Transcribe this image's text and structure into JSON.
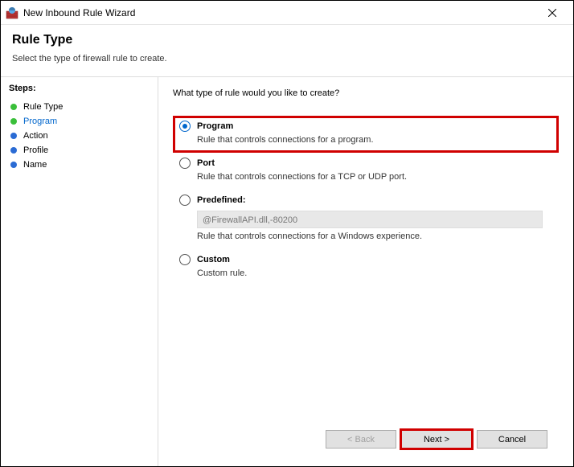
{
  "window": {
    "title": "New Inbound Rule Wizard"
  },
  "header": {
    "title": "Rule Type",
    "subtitle": "Select the type of firewall rule to create."
  },
  "sidebar": {
    "heading": "Steps:",
    "items": [
      {
        "label": "Rule Type",
        "bullet": "#3abf3a"
      },
      {
        "label": "Program",
        "bullet": "#3abf3a"
      },
      {
        "label": "Action",
        "bullet": "#2a6bd4"
      },
      {
        "label": "Profile",
        "bullet": "#2a6bd4"
      },
      {
        "label": "Name",
        "bullet": "#2a6bd4"
      }
    ],
    "current_index": 1
  },
  "content": {
    "question": "What type of rule would you like to create?",
    "options": [
      {
        "key": "program",
        "label": "Program",
        "desc": "Rule that controls connections for a program.",
        "highlight": true
      },
      {
        "key": "port",
        "label": "Port",
        "desc": "Rule that controls connections for a TCP or UDP port."
      },
      {
        "key": "predefined",
        "label": "Predefined:",
        "desc": "Rule that controls connections for a Windows experience.",
        "select_value": "@FirewallAPI.dll,-80200"
      },
      {
        "key": "custom",
        "label": "Custom",
        "desc": "Custom rule."
      }
    ],
    "selected": "program"
  },
  "footer": {
    "back": "< Back",
    "next": "Next >",
    "cancel": "Cancel",
    "back_enabled": false,
    "next_highlight": true
  }
}
